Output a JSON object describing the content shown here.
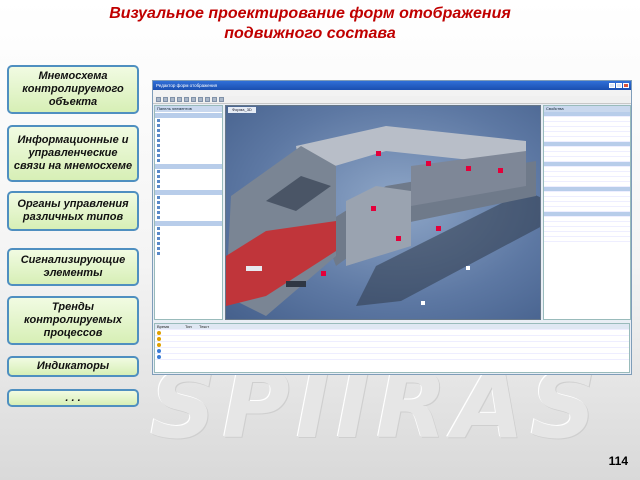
{
  "slide": {
    "title_line1": "Визуальное проектирование форм отображения",
    "title_line2": "подвижного состава",
    "page_number": "114",
    "watermark": "SPIIRAS"
  },
  "sidebar": {
    "items": [
      {
        "label": "Мнемосхема\nконтролируемого\nобъекта"
      },
      {
        "label": "Информационные и\nуправленческие\nсвязи на мнемосхеме"
      },
      {
        "label": "Органы управления\nразличных типов"
      },
      {
        "label": "Сигнализирующие\nэлементы"
      },
      {
        "label": "Тренды\nконтролируемых\nпроцессов"
      },
      {
        "label": "Индикаторы"
      },
      {
        "label": ". . ."
      }
    ]
  },
  "app": {
    "window_title": "Редактор форм отображения",
    "viewport_tab": "Форма_3D",
    "toolbox_header": "Панель элементов",
    "properties_header": "Свойства",
    "log_columns": [
      "Время",
      "Тип",
      "Текст"
    ],
    "colors": {
      "titlebar": "#1b4fb0",
      "panel_header": "#c9d8ee",
      "train_red": "#c0353a",
      "train_grey": "#7a8594",
      "marker": "#e4003a"
    }
  }
}
